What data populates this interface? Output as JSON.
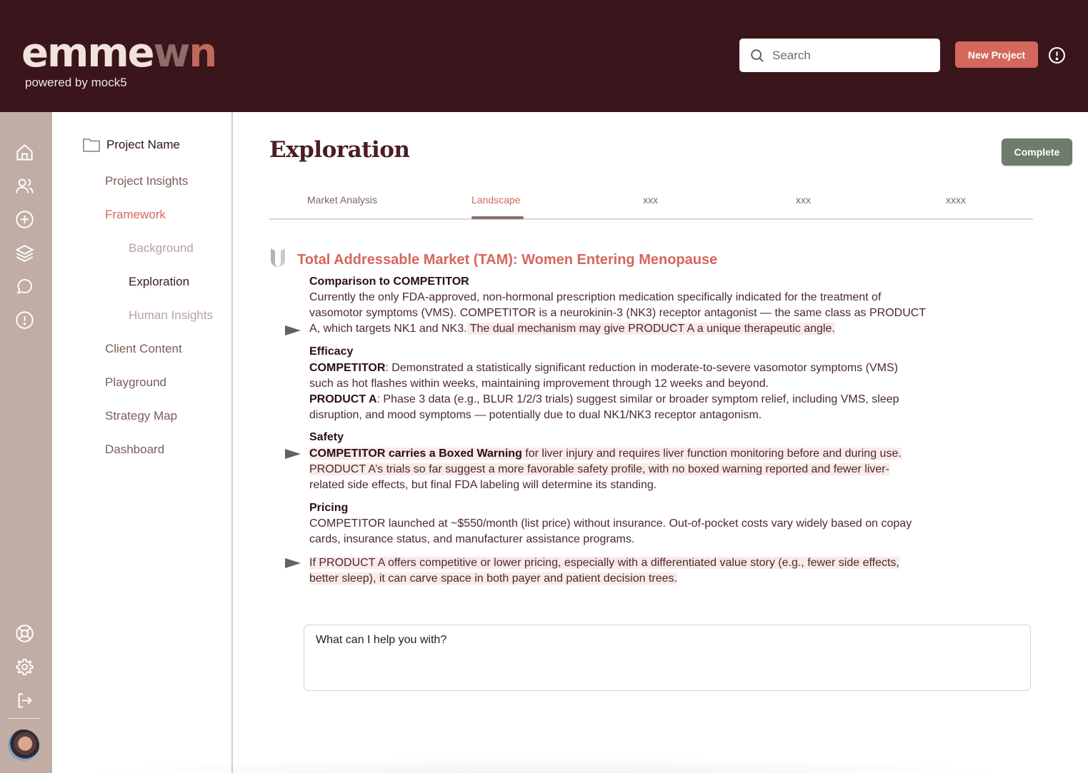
{
  "header": {
    "logo_main": "emme",
    "logo_accent": "w",
    "logo_accent2": "n",
    "powered_by": "powered by mock5",
    "search_placeholder": "Search",
    "new_project_label": "New Project"
  },
  "rail": {
    "icons": [
      "home-icon",
      "users-icon",
      "plus-circle-icon",
      "layers-icon",
      "chat-icon",
      "alert-icon",
      "help-icon",
      "settings-icon",
      "logout-icon"
    ]
  },
  "project_nav": {
    "project_name": "Project Name",
    "items": [
      {
        "label": "Project Insights"
      },
      {
        "label": "Framework"
      },
      {
        "label": "Background"
      },
      {
        "label": "Exploration"
      },
      {
        "label": "Human Insights"
      },
      {
        "label": "Client Content"
      },
      {
        "label": "Playground"
      },
      {
        "label": "Strategy Map"
      },
      {
        "label": "Dashboard"
      }
    ]
  },
  "main": {
    "title": "Exploration",
    "complete_label": "Complete",
    "tabs": [
      {
        "label": "Market Analysis"
      },
      {
        "label": "Landscape"
      },
      {
        "label": "xxx"
      },
      {
        "label": "xxx"
      },
      {
        "label": "xxxx"
      }
    ],
    "tam_title": "Total Addressable Market (TAM): Women Entering Menopause",
    "sections": {
      "comparison": {
        "heading": "Comparison to COMPETITOR",
        "line1": "Currently the only FDA-approved, non-hormonal prescription medication specifically indicated for the treatment of",
        "line2": "vasomotor symptoms (VMS). COMPETITOR is a neurokinin-3 (NK3) receptor antagonist — the same class as PRODUCT",
        "line3a": "A, which targets NK1 and NK3.",
        "line3b": " The dual mechanism may give PRODUCT A a unique therapeutic angle."
      },
      "efficacy": {
        "heading": "Efficacy",
        "competitor_label": "COMPETITOR",
        "competitor_text1": ": Demonstrated a statistically significant reduction in moderate-to-severe vasomotor symptoms (VMS)",
        "competitor_text2": "such as hot flashes within weeks, maintaining improvement through 12 weeks and beyond.",
        "product_label": "PRODUCT A",
        "product_text1": ": Phase 3 data (e.g., BLUR 1/2/3 trials) suggest similar or broader symptom relief, including VMS, sleep",
        "product_text2": "disruption, and mood symptoms — potentially due to dual NK1/NK3 receptor antagonism."
      },
      "safety": {
        "heading": "Safety",
        "bold": "COMPETITOR carries a Boxed Warning",
        "text1": " for liver injury and requires liver function monitoring before and during use.",
        "text2": "PRODUCT A’s trials so far suggest a more favorable safety profile, with no boxed warning reported and fewer liver-",
        "text3": "related side effects, but final FDA labeling will determine its standing."
      },
      "pricing": {
        "heading": "Pricing",
        "text1": "COMPETITOR launched at ~$550/month (list price) without insurance. Out-of-pocket costs vary widely based on copay",
        "text2": "cards, insurance status, and manufacturer assistance programs.",
        "hl1": "If PRODUCT A offers competitive or lower pricing, especially with a differentiated value story (e.g., fewer side effects,",
        "hl2": "better sleep), it can carve space in both payer and patient decision trees."
      }
    },
    "chat_placeholder": "What can I help you with?"
  },
  "colors": {
    "header_bg": "#3a151b",
    "rail_bg": "#c1ada3",
    "accent": "#d5675c",
    "complete_bg": "#6f7b6b",
    "highlight": "#f9ebe8"
  }
}
